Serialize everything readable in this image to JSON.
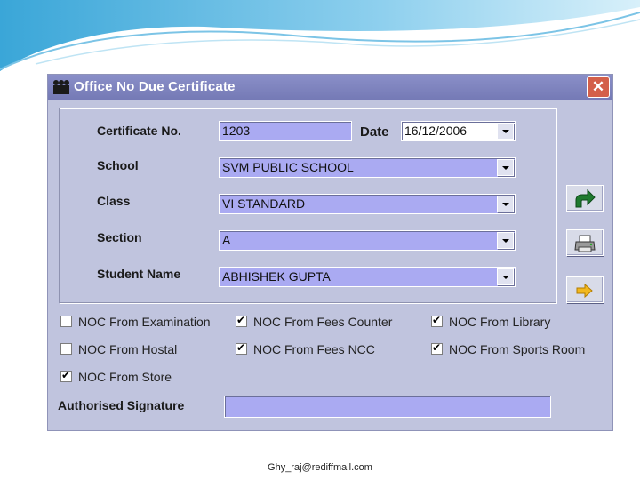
{
  "window": {
    "title": "Office No Due Certificate",
    "close_label": "✕"
  },
  "form": {
    "certificate_no": {
      "label": "Certificate No.",
      "value": "1203"
    },
    "date": {
      "label": "Date",
      "value": "16/12/2006"
    },
    "school": {
      "label": "School",
      "value": "SVM PUBLIC SCHOOL"
    },
    "class": {
      "label": "Class",
      "value": "VI STANDARD"
    },
    "section": {
      "label": "Section",
      "value": "A"
    },
    "student_name": {
      "label": "Student Name",
      "value": "ABHISHEK GUPTA"
    }
  },
  "checkboxes": [
    {
      "label": "NOC From Examination",
      "checked": false
    },
    {
      "label": "NOC From Fees Counter",
      "checked": true
    },
    {
      "label": "NOC From Library",
      "checked": true
    },
    {
      "label": "NOC From Hostal",
      "checked": false
    },
    {
      "label": "NOC From Fees NCC",
      "checked": true
    },
    {
      "label": "NOC From Sports Room",
      "checked": true
    },
    {
      "label": "NOC From Store",
      "checked": true
    }
  ],
  "signature": {
    "label": "Authorised Signature",
    "value": ""
  },
  "side_buttons": [
    "forward-arrow-icon",
    "printer-icon",
    "exit-arrow-icon"
  ],
  "footer": {
    "email": "Ghy_raj@rediffmail.com"
  },
  "colors": {
    "titlebar": "#7f84bf",
    "window": "#c0c4de",
    "field": "#aaaaf2"
  }
}
